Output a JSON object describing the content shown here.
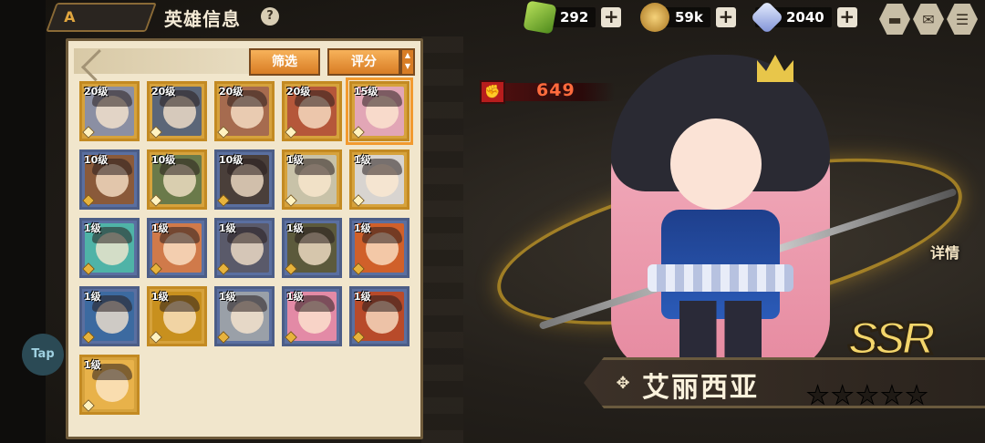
{
  "header": {
    "back_label": "A",
    "title": "英雄信息",
    "help_icon": "question-icon"
  },
  "currencies": [
    {
      "name": "green-gem",
      "value": "292",
      "color": "#7fc23a"
    },
    {
      "name": "gold-coin",
      "value": "59k",
      "color": "#e0a63f"
    },
    {
      "name": "crystal",
      "value": "2040",
      "color": "#b7c4ff"
    }
  ],
  "top_buttons": [
    {
      "icon": "chat-icon",
      "glyph": "▬"
    },
    {
      "icon": "mail-icon",
      "glyph": "✉"
    },
    {
      "icon": "menu-icon",
      "glyph": "☰"
    }
  ],
  "panel": {
    "filter_label": "筛选",
    "rating_label": "评分"
  },
  "heroes": [
    {
      "level": "20级",
      "rarity": "gold",
      "color": "#8b8fa3"
    },
    {
      "level": "20级",
      "rarity": "gold",
      "color": "#5b6678"
    },
    {
      "level": "20级",
      "rarity": "gold",
      "color": "#a66b4f"
    },
    {
      "level": "20级",
      "rarity": "gold",
      "color": "#b5573a"
    },
    {
      "level": "15级",
      "rarity": "gold",
      "color": "#e2a6b6"
    },
    {
      "level": "10级",
      "rarity": "blue",
      "color": "#8a5a3a"
    },
    {
      "level": "10级",
      "rarity": "gold",
      "color": "#6a7a4a"
    },
    {
      "level": "10级",
      "rarity": "blue",
      "color": "#4a3f3a"
    },
    {
      "level": "1级",
      "rarity": "gold",
      "color": "#c8c2a8"
    },
    {
      "level": "1级",
      "rarity": "gold",
      "color": "#d8d4d0"
    },
    {
      "level": "1级",
      "rarity": "blue",
      "color": "#4fb3a7"
    },
    {
      "level": "1级",
      "rarity": "blue",
      "color": "#d07a4a"
    },
    {
      "level": "1级",
      "rarity": "blue",
      "color": "#5a5a6a"
    },
    {
      "level": "1级",
      "rarity": "blue",
      "color": "#5c5a3c"
    },
    {
      "level": "1级",
      "rarity": "blue",
      "color": "#d0602a"
    },
    {
      "level": "1级",
      "rarity": "blue",
      "color": "#3c6aa0"
    },
    {
      "level": "1级",
      "rarity": "gold",
      "color": "#c8901e"
    },
    {
      "level": "1级",
      "rarity": "blue",
      "color": "#9aa0a8"
    },
    {
      "level": "1级",
      "rarity": "blue",
      "color": "#e38aa6"
    },
    {
      "level": "1级",
      "rarity": "blue",
      "color": "#b84a2a"
    },
    {
      "level": "1级",
      "rarity": "gold",
      "color": "#e8b24a"
    }
  ],
  "selected_hero": {
    "power": "649",
    "name": "艾丽西亚",
    "rarity": "SSR",
    "detail_label": "详情",
    "stars": 5
  },
  "floating": {
    "tap_label": "Tap"
  }
}
